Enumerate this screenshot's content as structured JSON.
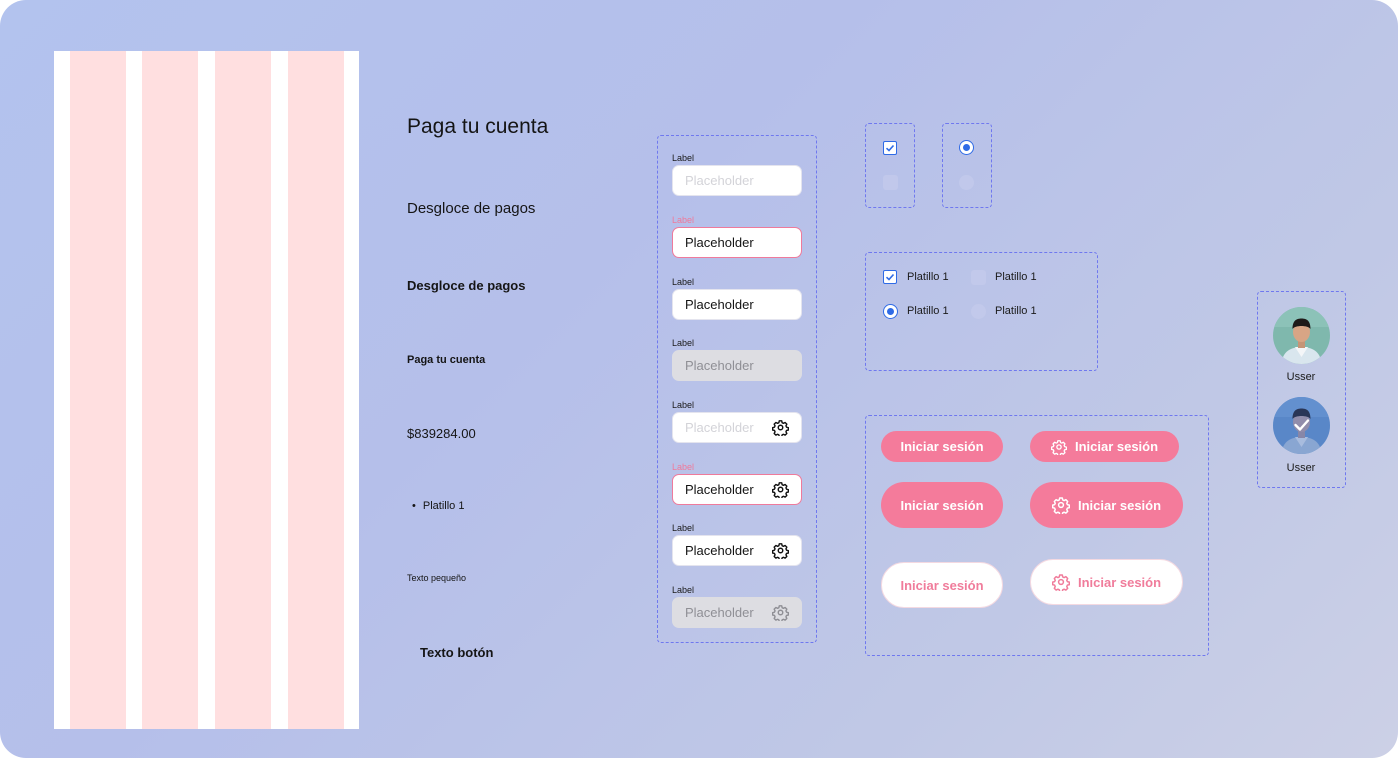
{
  "grid_preview": {
    "columns": 4,
    "colors": {
      "background": "#ffffff",
      "column": "#ffdfe0"
    }
  },
  "typography": {
    "heading_1": "Paga tu cuenta",
    "heading_2": "Desgloce de pagos",
    "heading_3": "Desgloce de pagos",
    "heading_4": "Paga tu cuenta",
    "price": "$839284.00",
    "bullet_item": "Platillo 1",
    "small_text": "Texto pequeño",
    "button_text": "Texto botón"
  },
  "inputs": [
    {
      "label": "Label",
      "value": "Placeholder",
      "state": "placeholder",
      "icon": null
    },
    {
      "label": "Label",
      "value": "Placeholder",
      "state": "error",
      "icon": null
    },
    {
      "label": "Label",
      "value": "Placeholder",
      "state": "filled",
      "icon": null
    },
    {
      "label": "Label",
      "value": "Placeholder",
      "state": "disabled",
      "icon": null
    },
    {
      "label": "Label",
      "value": "Placeholder",
      "state": "placeholder",
      "icon": "gear-icon"
    },
    {
      "label": "Label",
      "value": "Placeholder",
      "state": "error",
      "icon": "gear-icon"
    },
    {
      "label": "Label",
      "value": "Placeholder",
      "state": "filled",
      "icon": "gear-icon"
    },
    {
      "label": "Label",
      "value": "Placeholder",
      "state": "disabled",
      "icon": "gear-icon"
    }
  ],
  "selection_controls": {
    "options": [
      {
        "type": "checkbox",
        "checked": true,
        "label": "Platillo 1"
      },
      {
        "type": "checkbox",
        "checked": false,
        "label": "Platillo 1"
      },
      {
        "type": "radio",
        "checked": true,
        "label": "Platillo 1"
      },
      {
        "type": "radio",
        "checked": false,
        "label": "Platillo 1"
      }
    ]
  },
  "buttons": {
    "label": "Iniciar sesión",
    "variants": [
      {
        "style": "solid",
        "size": "small",
        "icon": null
      },
      {
        "style": "solid",
        "size": "small",
        "icon": "gear-icon"
      },
      {
        "style": "solid",
        "size": "large",
        "icon": null
      },
      {
        "style": "solid",
        "size": "large",
        "icon": "gear-icon"
      },
      {
        "style": "outline",
        "size": "large",
        "icon": null
      },
      {
        "style": "outline",
        "size": "large",
        "icon": "gear-icon"
      }
    ],
    "colors": {
      "primary": "#f47b9b",
      "on_primary": "#ffffff"
    }
  },
  "avatars": [
    {
      "name": "Usser",
      "selected": false
    },
    {
      "name": "Usser",
      "selected": true
    }
  ],
  "colors": {
    "accent_blue": "#2f6be6",
    "error_pink": "#ef7a9b",
    "frame_dash": "#6f78ef",
    "disabled_bg": "#dddde2"
  }
}
